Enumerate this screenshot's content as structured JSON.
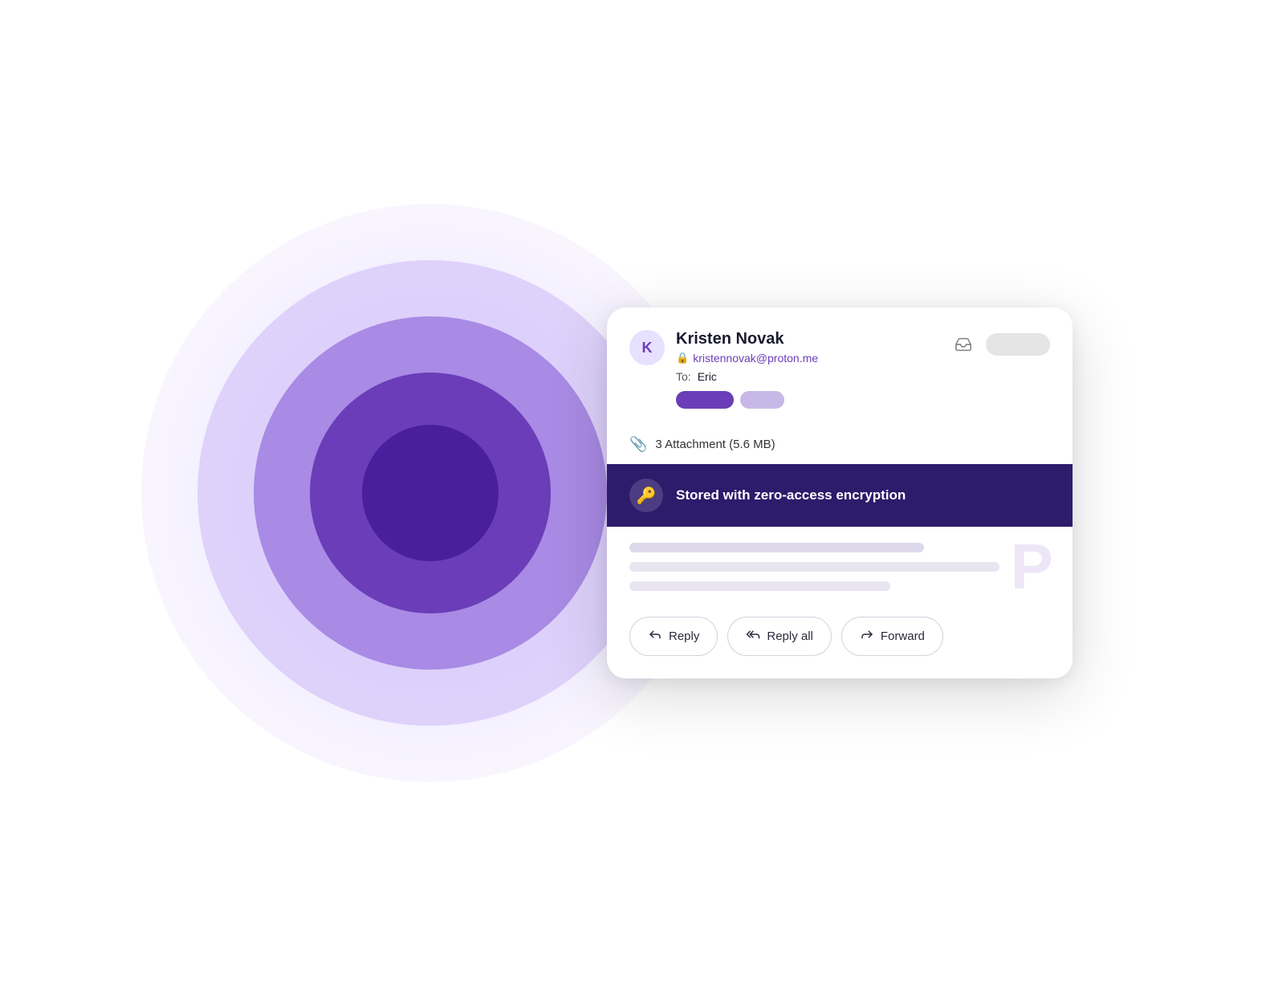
{
  "background": {
    "circles": [
      {
        "size": 720,
        "label": "outer-circle"
      },
      {
        "size": 580,
        "label": "circle-2"
      },
      {
        "size": 440,
        "label": "circle-3"
      },
      {
        "size": 300,
        "label": "circle-4"
      },
      {
        "size": 170,
        "label": "circle-5"
      }
    ]
  },
  "email_card": {
    "sender": {
      "avatar_letter": "K",
      "name": "Kristen Novak",
      "email": "kristennovak@proton.me",
      "email_color": "#6b3db8"
    },
    "to_label": "To:",
    "to_name": "Eric",
    "attachment_text": "3 Attachment (5.6 MB)",
    "encryption_banner": {
      "text": "Stored with zero-access encryption"
    },
    "body_lines": [
      {
        "width": "70%"
      },
      {
        "width": "88%"
      },
      {
        "width": "62%"
      }
    ],
    "actions": {
      "reply_label": "Reply",
      "reply_all_label": "Reply all",
      "forward_label": "Forward"
    }
  }
}
